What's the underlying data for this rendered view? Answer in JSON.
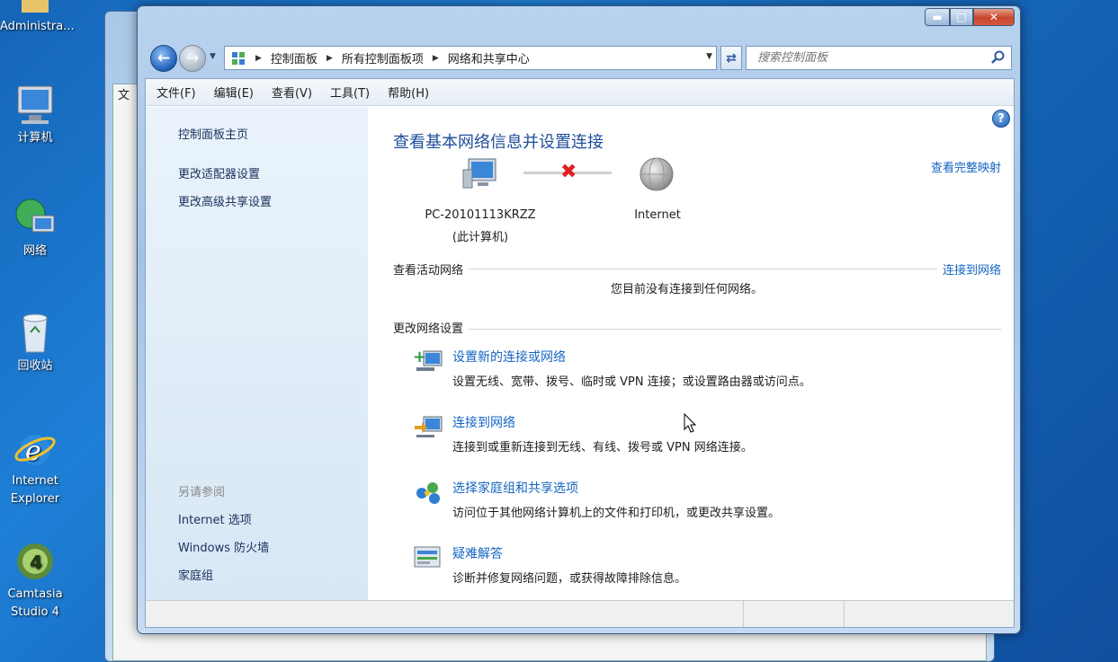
{
  "desktop": {
    "icons": [
      {
        "label": "Administra..."
      },
      {
        "label": "计算机"
      },
      {
        "label": "网络"
      },
      {
        "label": "回收站"
      },
      {
        "label": "Internet Explorer"
      },
      {
        "label": "Camtasia Studio 4"
      }
    ],
    "bg_window_menu": "文"
  },
  "window": {
    "address": {
      "crumbs": [
        "控制面板",
        "所有控制面板项",
        "网络和共享中心"
      ]
    },
    "search": {
      "placeholder": "搜索控制面板"
    },
    "menu": [
      "文件(F)",
      "编辑(E)",
      "查看(V)",
      "工具(T)",
      "帮助(H)"
    ],
    "left_pane": {
      "home": "控制面板主页",
      "links": [
        "更改适配器设置",
        "更改高级共享设置"
      ],
      "see_also_title": "另请参阅",
      "see_also": [
        "Internet 选项",
        "Windows 防火墙",
        "家庭组"
      ]
    },
    "main": {
      "heading": "查看基本网络信息并设置连接",
      "full_map": "查看完整映射",
      "pc_name": "PC-20101113KRZZ",
      "pc_sub": "(此计算机)",
      "internet": "Internet",
      "active_networks_label": "查看活动网络",
      "connect_link": "连接到网络",
      "no_network": "您目前没有连接到任何网络。",
      "change_settings_label": "更改网络设置",
      "tasks": [
        {
          "title": "设置新的连接或网络",
          "desc": "设置无线、宽带、拨号、临时或 VPN 连接；或设置路由器或访问点。",
          "icon": "network-setup-icon"
        },
        {
          "title": "连接到网络",
          "desc": "连接到或重新连接到无线、有线、拨号或 VPN 网络连接。",
          "icon": "connect-network-icon"
        },
        {
          "title": "选择家庭组和共享选项",
          "desc": "访问位于其他网络计算机上的文件和打印机，或更改共享设置。",
          "icon": "homegroup-icon"
        },
        {
          "title": "疑难解答",
          "desc": "诊断并修复网络问题，或获得故障排除信息。",
          "icon": "troubleshoot-icon"
        }
      ]
    }
  }
}
